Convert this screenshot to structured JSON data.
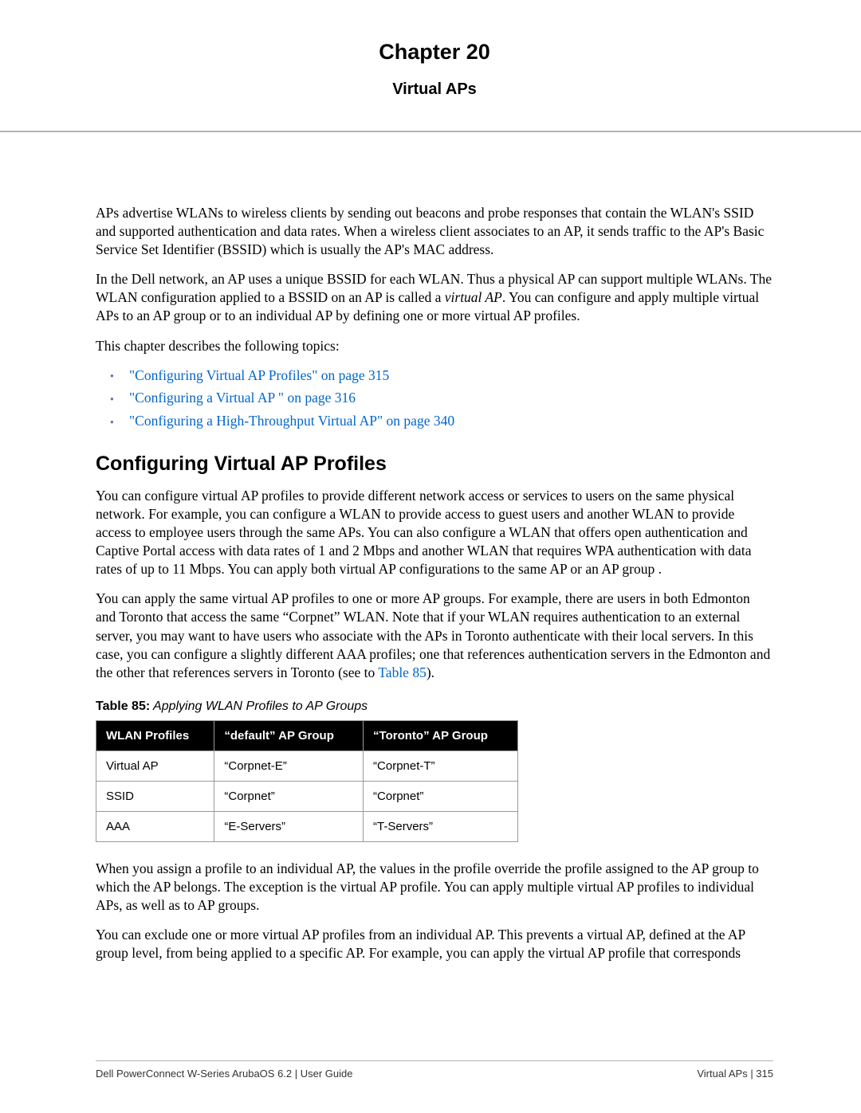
{
  "chapter_title": "Chapter 20",
  "subtitle": "Virtual APs",
  "para1": "APs advertise WLANs to wireless clients by sending out beacons and probe responses that contain the WLAN's SSID and supported authentication and data rates. When a wireless client associates to an AP, it sends traffic to the AP's Basic Service Set Identifier (BSSID) which is usually the AP's MAC address.",
  "para2_a": "In the Dell network, an AP uses a unique BSSID for each WLAN. Thus a physical AP can support multiple WLANs. The WLAN configuration applied to a BSSID on an AP is called a ",
  "para2_italic": "virtual AP",
  "para2_b": ". You can configure and apply multiple virtual APs to an AP group or to an individual AP by defining one or more virtual AP profiles.",
  "para3": "This chapter describes the following topics:",
  "toc": [
    "\"Configuring Virtual AP Profiles\" on page 315",
    "\"Configuring a Virtual AP \" on page 316",
    "\"Configuring a High-Throughput Virtual AP\" on page 340"
  ],
  "section_heading": "Configuring Virtual AP Profiles",
  "sec_para1": "You can configure virtual AP profiles to provide different network access or services to users on the same physical network. For example, you can configure a WLAN to provide access to guest users and another WLAN to provide access to employee users through the same APs. You can also configure a WLAN that offers open authentication and Captive Portal access with data rates of 1 and 2 Mbps and another WLAN that requires WPA authentication with data rates of up to 11 Mbps. You can apply both virtual AP configurations to the same AP or an AP group .",
  "sec_para2_a": "You can apply the same virtual AP profiles to one or more AP groups. For example, there are users in both Edmonton and Toronto that access the same “Corpnet” WLAN. Note that if your WLAN requires authentication to an external server, you may want to have users who associate with the APs in Toronto authenticate with their local servers. In this case, you can configure a slightly different AAA profiles; one that references authentication servers in the Edmonton and the other that references servers in Toronto (see to ",
  "sec_para2_link": "Table 85",
  "sec_para2_b": ").",
  "table_caption_bold": "Table 85:",
  "table_caption_italic": " Applying WLAN Profiles to AP Groups",
  "table": {
    "headers": [
      "WLAN Profiles",
      "“default” AP Group",
      "“Toronto” AP Group"
    ],
    "rows": [
      [
        "Virtual AP",
        "“Corpnet-E”",
        "“Corpnet-T”"
      ],
      [
        "SSID",
        "“Corpnet”",
        "“Corpnet”"
      ],
      [
        "AAA",
        "“E-Servers”",
        "“T-Servers”"
      ]
    ]
  },
  "para_after_table1": "When you assign a profile to an individual AP, the values in the profile override the profile assigned to the AP group to which the AP belongs. The exception is the virtual AP profile. You can apply multiple virtual AP profiles to individual APs, as well as to AP groups.",
  "para_after_table2": "You can exclude one or more virtual AP profiles from an individual AP. This prevents a virtual AP, defined at the AP group level, from being applied to a specific AP. For example, you can apply the virtual AP profile that corresponds",
  "footer_left": "Dell PowerConnect W-Series ArubaOS 6.2  |  User Guide",
  "footer_right": "Virtual APs | 315"
}
